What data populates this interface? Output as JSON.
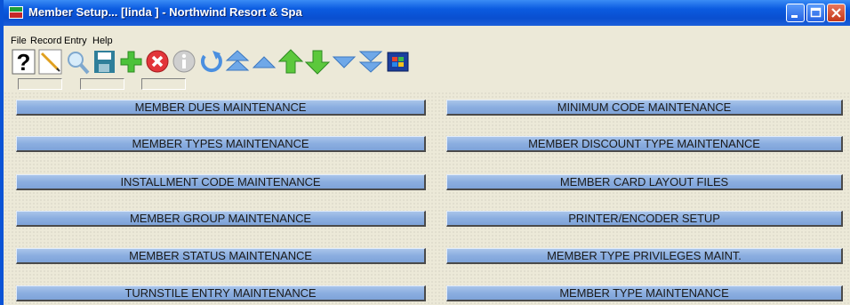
{
  "window": {
    "title": "Member Setup... [linda   ] - Northwind Resort & Spa",
    "controls": {
      "minimize": "minimize",
      "maximize": "maximize",
      "close": "close"
    }
  },
  "menu": [
    "File",
    "Record",
    "Entry",
    "Help"
  ],
  "toolbar": {
    "icons": [
      "help-icon",
      "edit-pencil-icon",
      "search-magnifier-icon",
      "save-floppy-icon",
      "add-plus-icon",
      "delete-x-icon",
      "info-icon",
      "undo-icon",
      "first-record-icon",
      "previous-record-icon",
      "up-icon",
      "down-icon",
      "next-record-icon",
      "last-record-icon",
      "windows-icon"
    ]
  },
  "buttons": {
    "left": [
      "MEMBER DUES MAINTENANCE",
      "MEMBER TYPES MAINTENANCE",
      "INSTALLMENT CODE MAINTENANCE",
      "MEMBER GROUP MAINTENANCE",
      "MEMBER STATUS MAINTENANCE",
      "TURNSTILE ENTRY MAINTENANCE"
    ],
    "right": [
      "MINIMUM CODE MAINTENANCE",
      "MEMBER DISCOUNT TYPE MAINTENANCE",
      "MEMBER CARD LAYOUT FILES",
      "PRINTER/ENCODER SETUP",
      "MEMBER TYPE PRIVILEGES MAINT.",
      "MEMBER TYPE MAINTENANCE"
    ]
  },
  "colors": {
    "titlebar": "#0A4FD0",
    "button": "#8BAEE0",
    "background": "#ECE9D8"
  }
}
